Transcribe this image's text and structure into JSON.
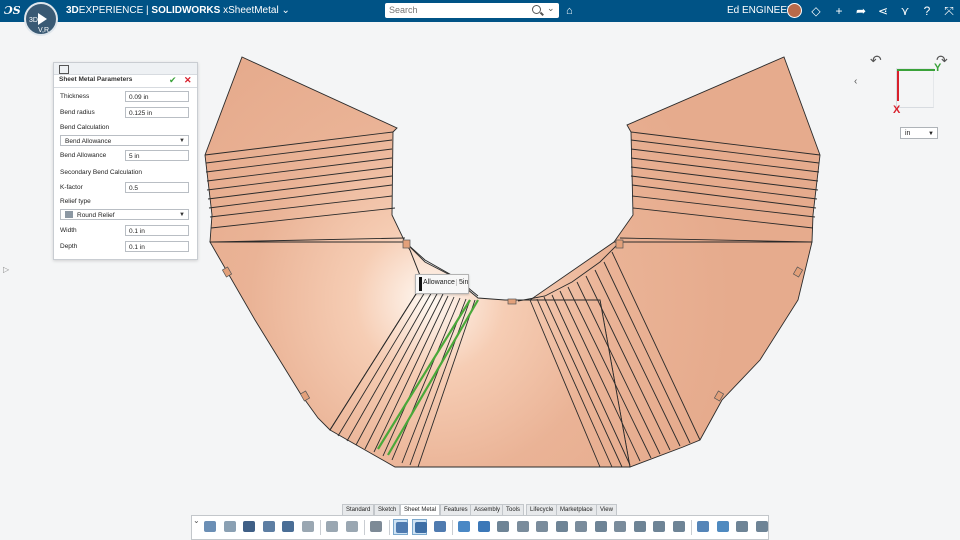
{
  "topbar": {
    "brand_bold_1": "3D",
    "brand_1": "EXPERIENCE | ",
    "brand_bold_2": "SOLIDWORKS",
    "brand_app": " xSheetMetal",
    "search_placeholder": "Search",
    "user_name": "Ed ENGINEER",
    "compass_labels": [
      "3D",
      "V,R"
    ]
  },
  "panel": {
    "title": "Sheet Metal Parameters",
    "thickness_label": "Thickness",
    "thickness_value": "0.09 in",
    "bend_radius_label": "Bend radius",
    "bend_radius_value": "0.125 in",
    "bend_calc_label": "Bend Calculation",
    "bend_calc_value": "Bend Allowance",
    "bend_allowance_label": "Bend Allowance",
    "bend_allowance_value": "5 in",
    "secondary_label": "Secondary Bend Calculation",
    "kfactor_label": "K-factor",
    "kfactor_value": "0.5",
    "relief_type_label": "Relief type",
    "relief_type_value": "Round Relief",
    "width_label": "Width",
    "width_value": "0.1 in",
    "depth_label": "Depth",
    "depth_value": "0.1 in"
  },
  "viewport": {
    "triad_x": "X",
    "triad_y": "Y",
    "units_value": "in",
    "tooltip_label": "Allowance",
    "tooltip_value": "5in",
    "colors": {
      "part_fill": "#eab396",
      "part_highlight": "#fff6ee",
      "edge": "#2a2a2a",
      "selected_bend": "#4aa83a"
    }
  },
  "tabs": [
    {
      "label": "Standard"
    },
    {
      "label": "Sketch"
    },
    {
      "label": "Sheet Metal",
      "active": true
    },
    {
      "label": "Features"
    },
    {
      "label": "Assembly"
    },
    {
      "label": "Tools"
    },
    {
      "label": "Lifecycle"
    },
    {
      "label": "Marketplace"
    },
    {
      "label": "View"
    }
  ],
  "toolbar_icons": [
    "import-icon",
    "export-icon",
    "save-icon",
    "save-options-icon",
    "snapshot-icon",
    "settings-gear-icon",
    "undo-icon",
    "redo-icon",
    "help-icon",
    "sheet-metal-params-icon",
    "convert-to-sheet-metal-icon",
    "thicken-icon",
    "base-flange-icon",
    "box-icon",
    "edge-flange-icon",
    "tab-icon",
    "hem-icon",
    "sketched-bend-icon",
    "jog-icon",
    "miter-flange-icon",
    "closed-corner-icon",
    "corner-relief-icon",
    "forming-tool-icon",
    "unfold-icon",
    "fold-icon",
    "flatten-icon",
    "flat-pattern-icon",
    "insert-bends-icon"
  ]
}
